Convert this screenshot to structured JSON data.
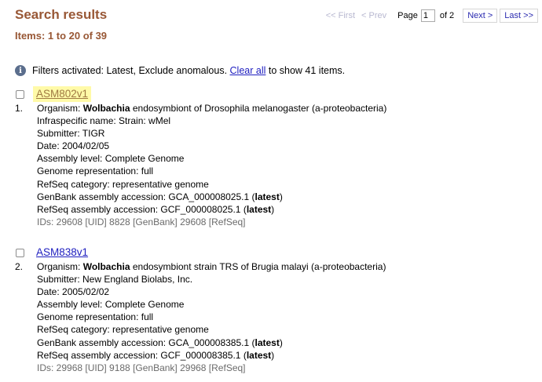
{
  "header": {
    "title": "Search results",
    "items_text": "Items: 1 to 20 of 39"
  },
  "pager": {
    "first": "<< First",
    "prev": "< Prev",
    "page_label": "Page",
    "page_value": "1",
    "of_text": "of 2",
    "next": "Next >",
    "last": "Last >>"
  },
  "filters": {
    "icon": "info-icon",
    "text_before": "Filters activated: Latest, Exclude anomalous.",
    "clear_all": "Clear all",
    "text_after": "to show 41 items."
  },
  "results": [
    {
      "number": "1.",
      "title": "ASM802v1",
      "organism_label": "Organism:",
      "organism_bold": "Wolbachia",
      "organism_rest": "endosymbiont of Drosophila melanogaster (a-proteobacteria)",
      "infraspecific": "Infraspecific name: Strain: wMel",
      "submitter": "Submitter: TIGR",
      "date": "Date: 2004/02/05",
      "assembly_level": "Assembly level: Complete Genome",
      "genome_rep": "Genome representation: full",
      "refseq_category": "RefSeq category: representative genome",
      "genbank_label": "GenBank assembly accession: GCA_000008025.1 (",
      "genbank_latest": "latest",
      "refseq_label": "RefSeq assembly accession: GCF_000008025.1 (",
      "refseq_latest": "latest",
      "close_paren": ")",
      "ids": "IDs: 29608 [UID] 8828 [GenBank] 29608 [RefSeq]"
    },
    {
      "number": "2.",
      "title": "ASM838v1",
      "organism_label": "Organism:",
      "organism_bold": "Wolbachia",
      "organism_rest": "endosymbiont strain TRS of Brugia malayi (a-proteobacteria)",
      "submitter": "Submitter: New England Biolabs, Inc.",
      "date": "Date: 2005/02/02",
      "assembly_level": "Assembly level: Complete Genome",
      "genome_rep": "Genome representation: full",
      "refseq_category": "RefSeq category: representative genome",
      "genbank_label": "GenBank assembly accession: GCA_000008385.1 (",
      "genbank_latest": "latest",
      "refseq_label": "RefSeq assembly accession: GCF_000008385.1 (",
      "refseq_latest": "latest",
      "close_paren": ")",
      "ids": "IDs: 29968 [UID] 9188 [GenBank] 29968 [RefSeq]"
    }
  ]
}
